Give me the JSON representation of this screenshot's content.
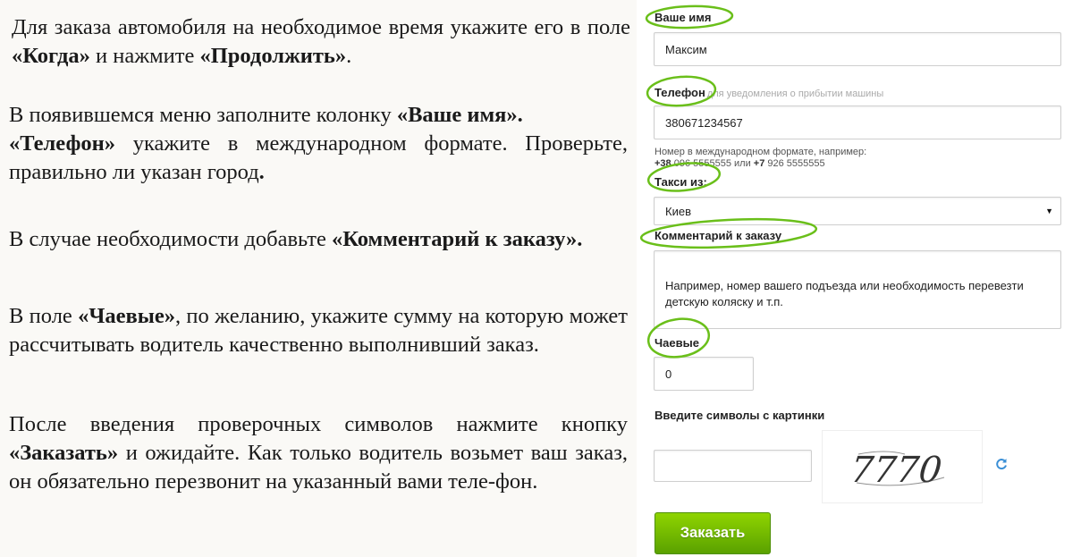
{
  "instructions": {
    "p1": {
      "t1": "Для заказа автомобиля на необходимое время укажите его в поле ",
      "b1": "«Когда»",
      "t2": " и нажмите ",
      "b2": "«Продолжить»",
      "t3": "."
    },
    "p2": {
      "t1": "В появившемся меню заполните колонку ",
      "b1": "«Ваше имя».",
      "b2": "«Телефон»",
      "t2": " укажите в международном формате. Проверьте, правильно ли указан город",
      "b3": "."
    },
    "p3": {
      "t1": "В случае необходимости добавьте ",
      "b1": "«Комментарий к заказу»."
    },
    "p4": {
      "t1": "В поле ",
      "b1": "«Чаевые»",
      "t2": ", по желанию, укажите сумму на которую может рассчитывать водитель качественно выполнивший заказ."
    },
    "p5": {
      "t1": "После введения проверочных символов нажмите кнопку ",
      "b1": "«Заказать»",
      "t2": " и ожидайте. Как только водитель возьмет ваш заказ, он обязательно перезвонит на указанный вами теле-фон."
    }
  },
  "form": {
    "name_label": "Ваше имя",
    "name_value": "Максим",
    "phone_label": "Телефон",
    "phone_hint": "для уведомления о прибытии машины",
    "phone_value": "380671234567",
    "phone_note_line1": "Номер в международном формате, например:",
    "phone_note_ex1": "+38",
    "phone_note_ex1_rest": " 096 5555555 или ",
    "phone_note_ex2": "+7",
    "phone_note_ex2_rest": " 926 5555555",
    "city_label": "Такси из:",
    "city_value": "Киев",
    "comment_label": "Комментарий к заказу",
    "comment_placeholder": "Например, номер вашего подъезда или необходимость перевезти детскую коляску и т.п.",
    "tips_label": "Чаевые",
    "tips_placeholder": "0",
    "captcha_label": "Введите символы с картинки",
    "captcha_text": "7770",
    "submit_label": "Заказать"
  },
  "colors": {
    "accent_green": "#5aa100",
    "oval_green": "#6abf1a"
  },
  "icons": {
    "select_caret": "caret-down-icon",
    "refresh": "refresh-icon"
  }
}
